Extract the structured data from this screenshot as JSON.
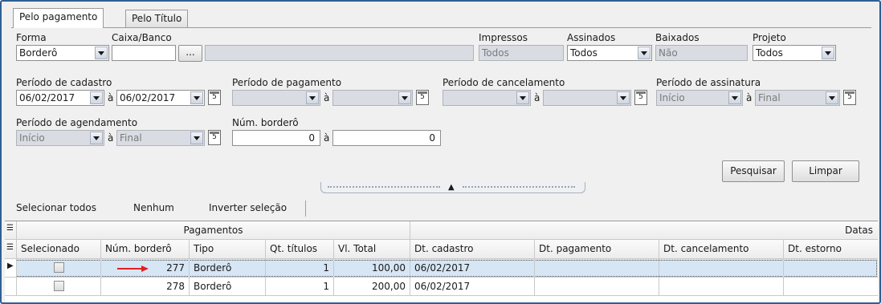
{
  "tabs": [
    "Pelo pagamento",
    "Pelo Título"
  ],
  "filters": {
    "forma": {
      "label": "Forma",
      "value": "Borderô"
    },
    "caixa_banco": {
      "label": "Caixa/Banco",
      "value": "",
      "browse": "...",
      "desc": ""
    },
    "impressos": {
      "label": "Impressos",
      "value": "Todos"
    },
    "assinados": {
      "label": "Assinados",
      "value": "Todos"
    },
    "baixados": {
      "label": "Baixados",
      "value": "Não"
    },
    "projeto": {
      "label": "Projeto",
      "value": "Todos"
    },
    "periodo_cadastro": {
      "label": "Período de cadastro",
      "from": "06/02/2017",
      "to": "06/02/2017"
    },
    "periodo_pagamento": {
      "label": "Período de pagamento",
      "from": "",
      "to": ""
    },
    "periodo_cancelamento": {
      "label": "Período de cancelamento",
      "from": "",
      "to": ""
    },
    "periodo_assinatura": {
      "label": "Período de assinatura",
      "from": "Início",
      "to": "Final"
    },
    "periodo_agendamento": {
      "label": "Período de agendamento",
      "from": "Início",
      "to": "Final"
    },
    "num_bordero": {
      "label": "Núm. borderô",
      "from": "0",
      "to": "0"
    },
    "range_sep": "à"
  },
  "buttons": {
    "search": "Pesquisar",
    "clear": "Limpar"
  },
  "selection": {
    "all": "Selecionar todos",
    "none": "Nenhum",
    "invert": "Inverter seleção"
  },
  "grid": {
    "groups": {
      "pagamentos": "Pagamentos",
      "datas": "Datas"
    },
    "columns": [
      "Selecionado",
      "Núm. borderô",
      "Tipo",
      "Qt. títulos",
      "Vl. Total",
      "Dt. cadastro",
      "Dt. pagamento",
      "Dt. cancelamento",
      "Dt. estorno"
    ],
    "rows": [
      {
        "selected": false,
        "num": "277",
        "tipo": "Borderô",
        "qt": "1",
        "total": "100,00",
        "cadastro": "06/02/2017",
        "pagamento": "",
        "cancelamento": "",
        "estorno": "",
        "current": true
      },
      {
        "selected": false,
        "num": "278",
        "tipo": "Borderô",
        "qt": "1",
        "total": "200,00",
        "cadastro": "06/02/2017",
        "pagamento": "",
        "cancelamento": "",
        "estorno": "",
        "current": false
      }
    ]
  },
  "colors": {
    "frame_border": "#2e5f96",
    "arrow": "#e02020",
    "selected_row": "#d6e6f5"
  }
}
